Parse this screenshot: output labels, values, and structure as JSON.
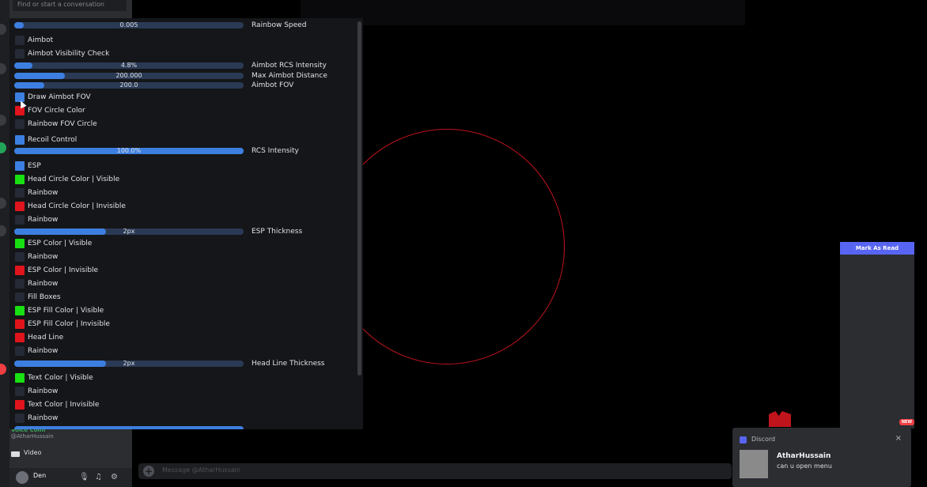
{
  "discord": {
    "search_placeholder": "Find or start a conversation",
    "voice_status": "Voice Conn",
    "voice_user": "@AtharHussain",
    "video_label": "Video",
    "user_name": "Den",
    "message_placeholder": "Message @AtharHussain",
    "inbox_mark_read": "Mark As Read",
    "inbox_badge": "NEW"
  },
  "notification": {
    "app": "Discord",
    "title": "AtharHussain",
    "body": "can u open menu",
    "close": "×"
  },
  "menu": {
    "sliders": {
      "rainbow_speed": {
        "value_text": "0.005",
        "label": "Rainbow Speed",
        "fill": 0.04
      },
      "aimbot_rcs": {
        "value_text": "4.8%",
        "label": "Aimbot RCS Intensity",
        "fill": 0.08
      },
      "aimbot_distance": {
        "value_text": "200.000",
        "label": "Max Aimbot Distance",
        "fill": 0.22
      },
      "aimbot_fov": {
        "value_text": "200.0",
        "label": "Aimbot FOV",
        "fill": 0.13
      },
      "rcs": {
        "value_text": "100.0%",
        "label": "RCS Intensity",
        "fill": 1.0
      },
      "esp_thickness": {
        "value_text": "2px",
        "label": "ESP Thickness",
        "fill": 0.4
      },
      "headline_thickness": {
        "value_text": "2px",
        "label": "Head Line Thickness",
        "fill": 0.4
      }
    },
    "options": {
      "aimbot": "Aimbot",
      "aimbot_vis": "Aimbot Visibility Check",
      "draw_fov": "Draw Aimbot FOV",
      "fov_color": "FOV Circle Color",
      "rainbow_fov": "Rainbow FOV Circle",
      "recoil": "Recoil Control",
      "esp": "ESP",
      "head_vis": "Head Circle Color | Visible",
      "rainbow_1": "Rainbow",
      "head_invis": "Head Circle Color | Invisible",
      "rainbow_2": "Rainbow",
      "esp_vis": "ESP Color | Visible",
      "rainbow_3": "Rainbow",
      "esp_invis": "ESP Color | Invisible",
      "rainbow_4": "Rainbow",
      "fill_boxes": "Fill Boxes",
      "fill_vis": "ESP Fill Color | Visible",
      "fill_invis": "ESP Fill Color | Invisible",
      "head_line": "Head Line",
      "rainbow_5": "Rainbow",
      "text_vis": "Text Color | Visible",
      "rainbow_6": "Rainbow",
      "text_invis": "Text Color | Invisible",
      "rainbow_7": "Rainbow"
    }
  },
  "colors": {
    "accent": "#3d7fe0",
    "green": "#18e012",
    "red": "#e0141c",
    "fov_circle": "#c0141c"
  }
}
